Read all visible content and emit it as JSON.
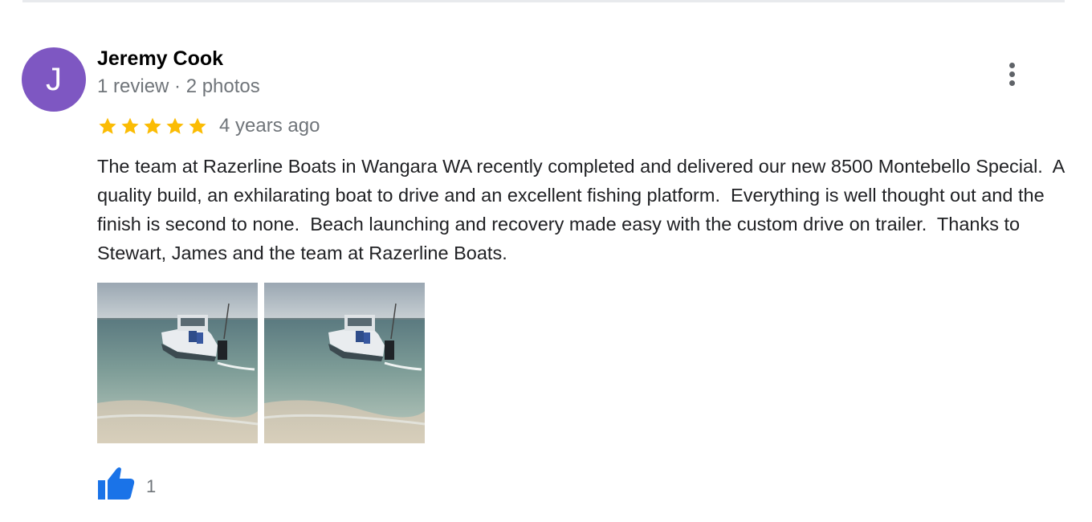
{
  "review": {
    "author": {
      "initial": "J",
      "name": "Jeremy Cook",
      "meta": "1 review · 2 photos",
      "avatar_color": "#7e57c2"
    },
    "rating": 5,
    "star_color": "#fbbc04",
    "time": "4 years ago",
    "text": "The team at Razerline Boats in Wangara WA recently completed and delivered our new 8500 Montebello Special.  A quality build, an exhilarating boat to drive and an excellent fishing platform.  Everything is well thought out and the finish is second to none.  Beach launching and recovery made easy with the custom drive on trailer.  Thanks to Stewart, James and the team at Razerline Boats.",
    "photos": [
      "boat-photo",
      "boat-photo"
    ],
    "likes": "1",
    "like_color": "#1a73e8"
  }
}
